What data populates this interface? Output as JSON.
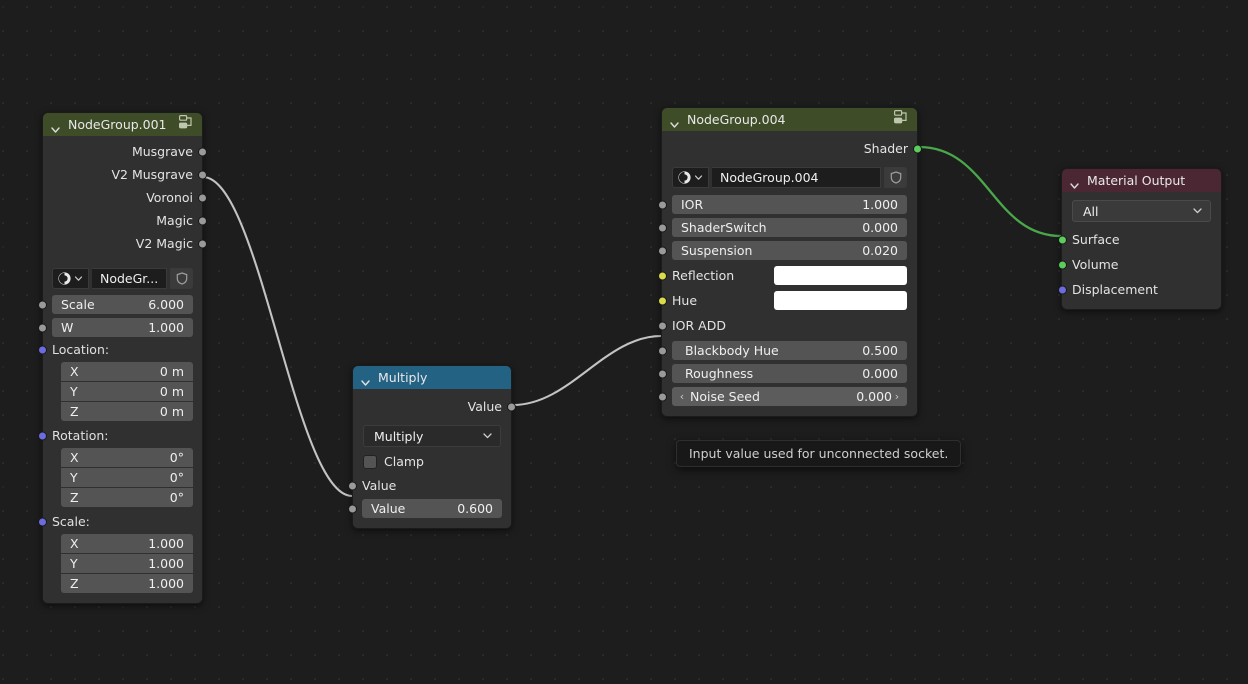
{
  "editor": {
    "background_color": "#1d1d1d",
    "grid_color": "#2a2a2a"
  },
  "colors": {
    "node_body": "#303030",
    "field": "#545454",
    "header_group": "#3f4c28",
    "header_math": "#246283",
    "header_output": "#4b2733",
    "socket_gray": "#9a9a9a",
    "socket_yellow": "#dcdc4b",
    "socket_purple": "#6c6ce0",
    "socket_green": "#5ccc5c",
    "link_gray": "#c0c0c0",
    "link_green": "#4faf4f"
  },
  "nodes": {
    "nodegroup001": {
      "title": "NodeGroup.001",
      "header_icon": "node-group-icon",
      "collapse_icon": "chevron-down-icon",
      "outputs": [
        {
          "label": "Musgrave",
          "socket": "gray"
        },
        {
          "label": "V2 Musgrave",
          "socket": "gray"
        },
        {
          "label": "Voronoi",
          "socket": "gray"
        },
        {
          "label": "Magic",
          "socket": "gray"
        },
        {
          "label": "V2 Magic",
          "socket": "gray"
        }
      ],
      "datablock": {
        "type_icon": "shading-sphere-icon",
        "dropdown_icon": "chevron-down-icon",
        "name": "NodeGr...",
        "shield_icon": "shield-icon"
      },
      "fields": [
        {
          "label": "Scale",
          "value": "6.000",
          "socket": "gray"
        },
        {
          "label": "W",
          "value": "1.000",
          "socket": "gray"
        }
      ],
      "vector_groups": [
        {
          "label": "Location:",
          "socket": "purple",
          "rows": [
            {
              "label": "X",
              "value": "0 m"
            },
            {
              "label": "Y",
              "value": "0 m"
            },
            {
              "label": "Z",
              "value": "0 m"
            }
          ]
        },
        {
          "label": "Rotation:",
          "socket": "purple",
          "rows": [
            {
              "label": "X",
              "value": "0°"
            },
            {
              "label": "Y",
              "value": "0°"
            },
            {
              "label": "Z",
              "value": "0°"
            }
          ]
        },
        {
          "label": "Scale:",
          "socket": "purple",
          "rows": [
            {
              "label": "X",
              "value": "1.000"
            },
            {
              "label": "Y",
              "value": "1.000"
            },
            {
              "label": "Z",
              "value": "1.000"
            }
          ]
        }
      ]
    },
    "multiply": {
      "title": "Multiply",
      "collapse_icon": "chevron-down-icon",
      "output": {
        "label": "Value",
        "socket": "gray"
      },
      "operation_dropdown": {
        "value": "Multiply",
        "icon": "chevron-down-icon"
      },
      "clamp": {
        "label": "Clamp",
        "checked": false
      },
      "inputs": [
        {
          "label": "Value",
          "socket": "gray",
          "type": "label"
        },
        {
          "label": "Value",
          "value": "0.600",
          "socket": "gray",
          "type": "field"
        }
      ]
    },
    "nodegroup004": {
      "title": "NodeGroup.004",
      "header_icon": "node-group-icon",
      "collapse_icon": "chevron-down-icon",
      "output": {
        "label": "Shader",
        "socket": "green"
      },
      "datablock": {
        "type_icon": "shading-sphere-icon",
        "dropdown_icon": "chevron-down-icon",
        "name": "NodeGroup.004",
        "shield_icon": "shield-icon"
      },
      "inputs": [
        {
          "label": "IOR",
          "value": "1.000",
          "socket": "gray",
          "type": "field"
        },
        {
          "label": "ShaderSwitch",
          "value": "0.000",
          "socket": "gray",
          "type": "field"
        },
        {
          "label": "Suspension",
          "value": "0.020",
          "socket": "gray",
          "type": "field"
        },
        {
          "label": "Reflection",
          "value": "",
          "socket": "yellow",
          "type": "color"
        },
        {
          "label": "Hue",
          "value": "",
          "socket": "yellow",
          "type": "color"
        },
        {
          "label": "IOR ADD",
          "socket": "gray",
          "type": "label"
        },
        {
          "label": "Blackbody Hue",
          "value": "0.500",
          "socket": "gray",
          "type": "field"
        },
        {
          "label": "Roughness",
          "value": "0.000",
          "socket": "gray",
          "type": "field"
        },
        {
          "label": "Noise Seed",
          "value": "0.000",
          "socket": "gray",
          "type": "field-arrows",
          "arrow_left": "‹",
          "arrow_right": "›"
        }
      ]
    },
    "material_output": {
      "title": "Material Output",
      "collapse_icon": "chevron-down-icon",
      "target_dropdown": {
        "value": "All",
        "icon": "chevron-down-icon"
      },
      "inputs": [
        {
          "label": "Surface",
          "socket": "green"
        },
        {
          "label": "Volume",
          "socket": "green"
        },
        {
          "label": "Displacement",
          "socket": "purple"
        }
      ]
    }
  },
  "tooltip": {
    "text": "Input value used for unconnected socket."
  }
}
